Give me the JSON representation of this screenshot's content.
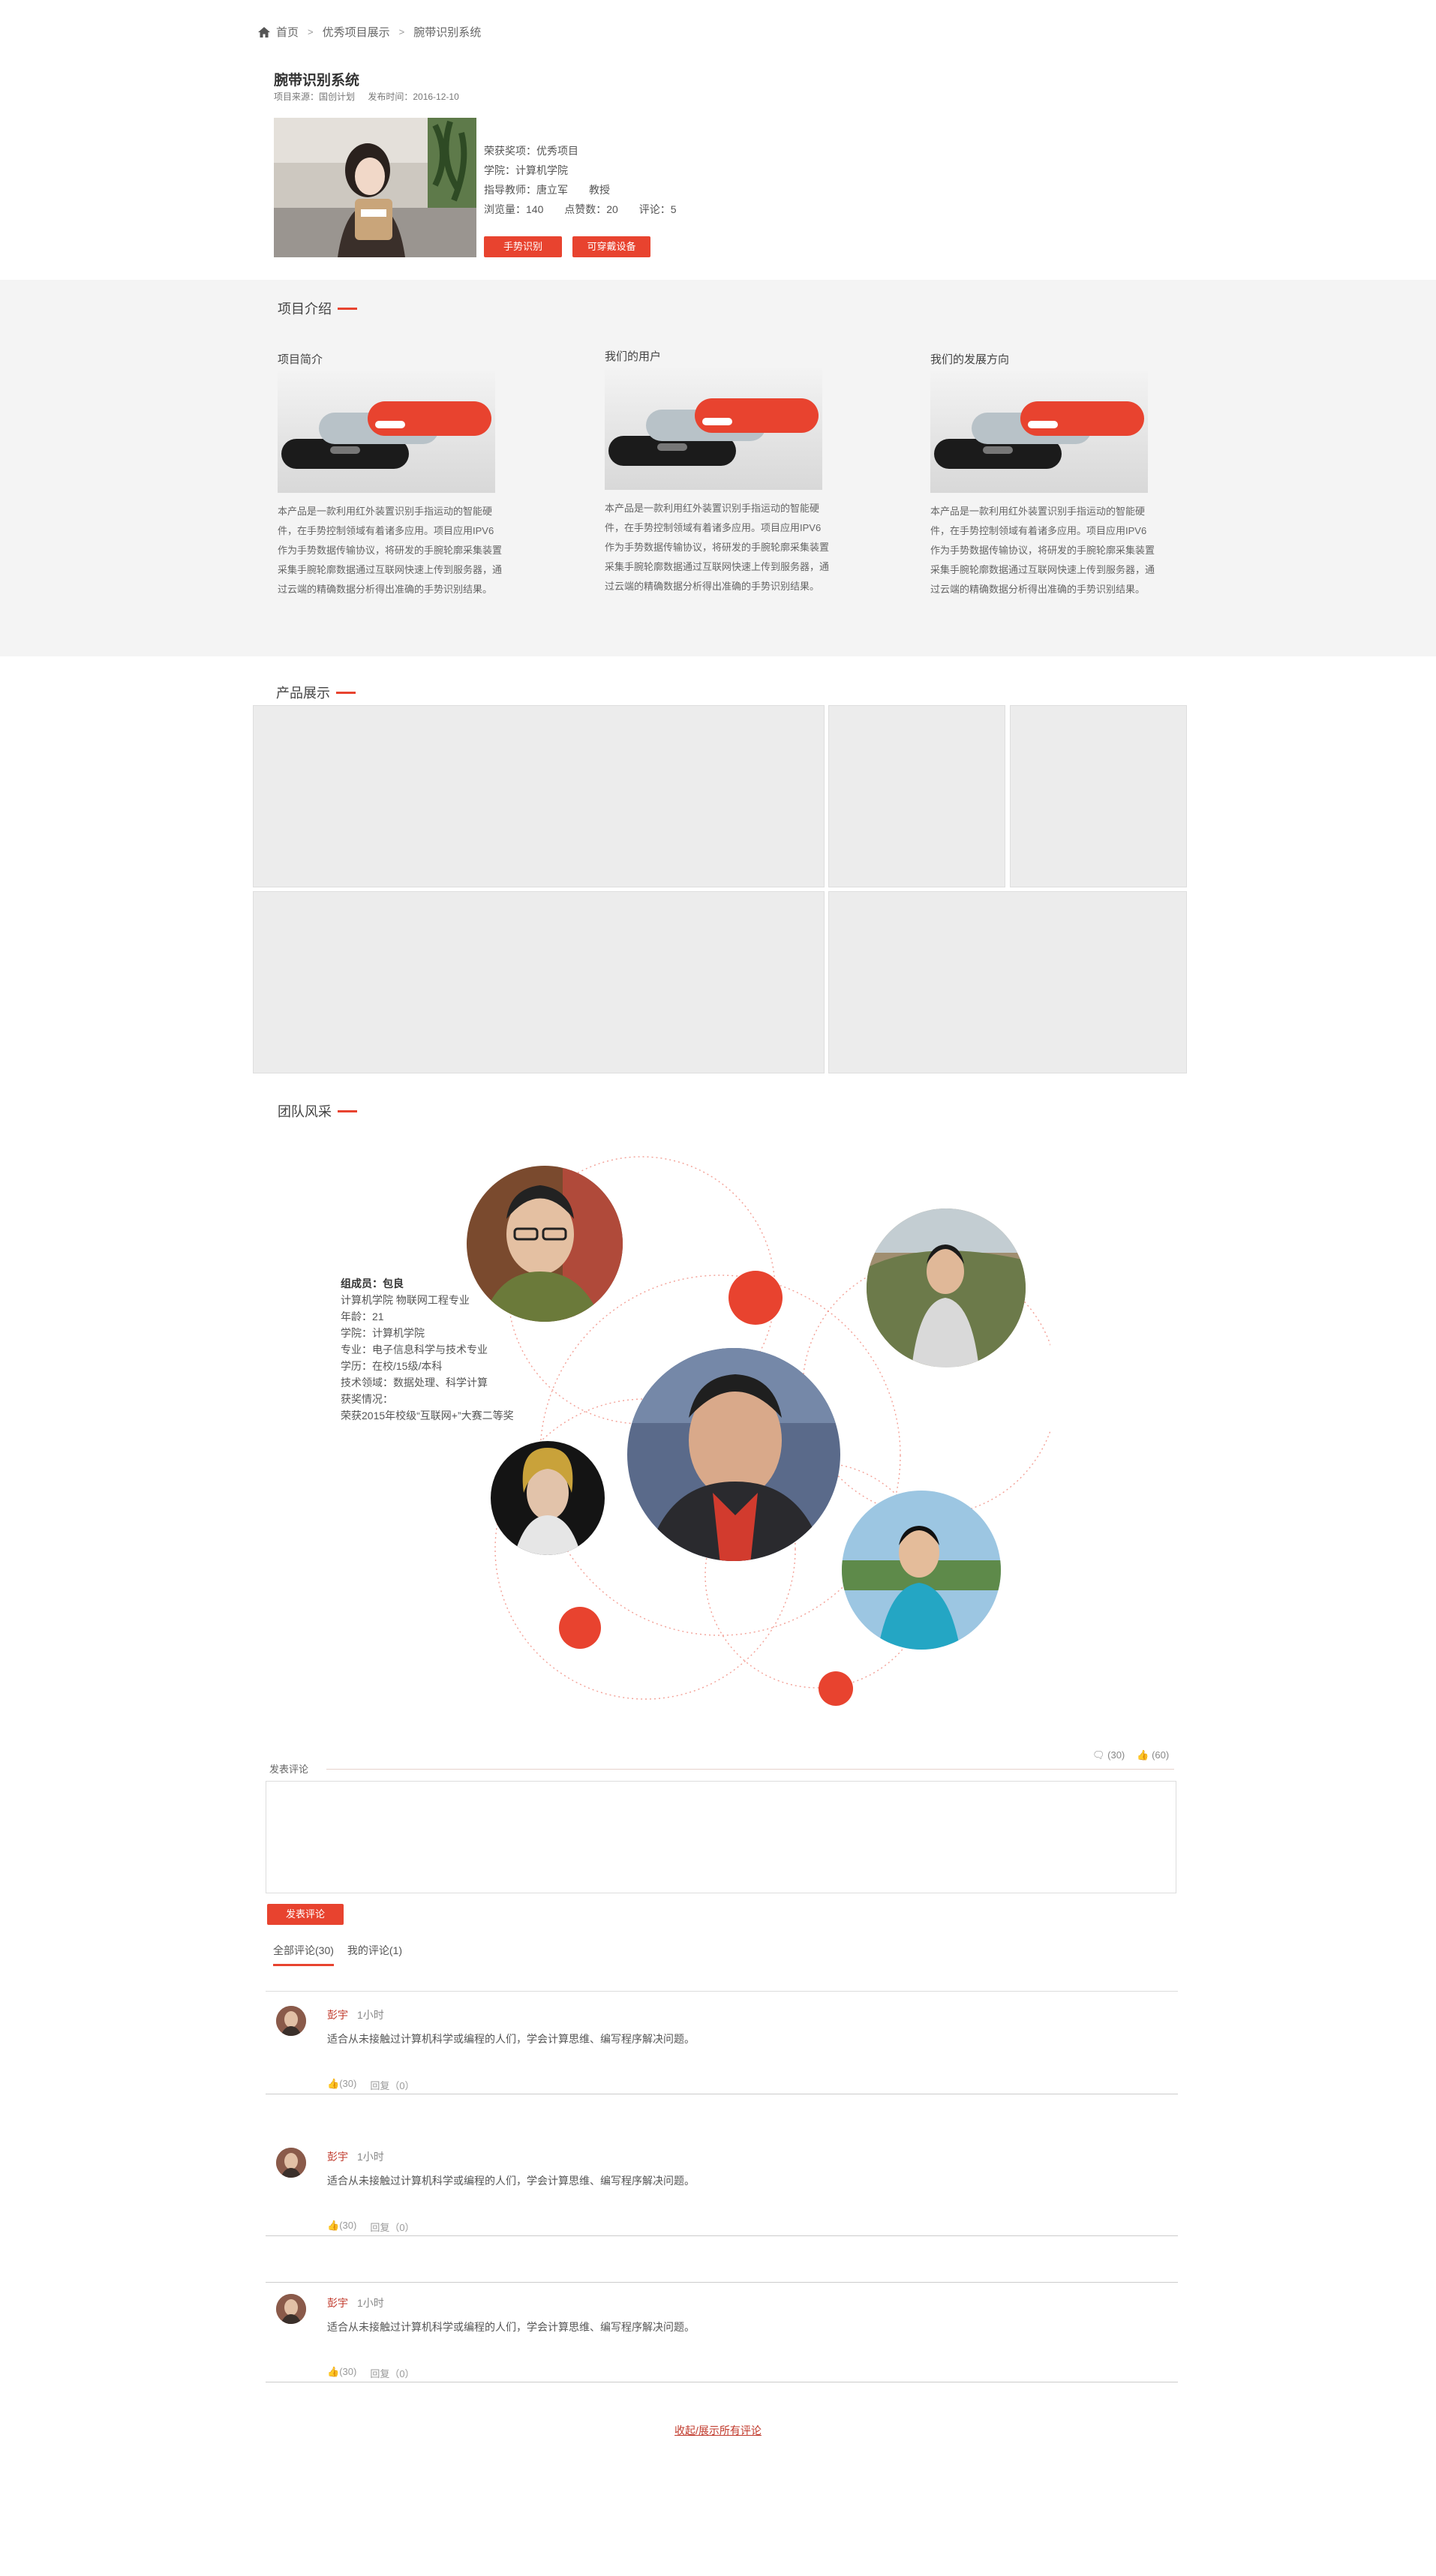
{
  "breadcrumb": {
    "home": "首页",
    "sep": ">",
    "level2": "优秀项目展示",
    "current": "腕带识别系统"
  },
  "project": {
    "title": "腕带识别系统",
    "source": "项目来源：国创计划",
    "date": "发布时间：2016-12-10",
    "award": "荣获奖项：优秀项目",
    "college": "学院：计算机学院",
    "advisor": "指导教师：唐立军　　教授",
    "views": "浏览量：140",
    "likes": "点赞数：20",
    "comments": "评论：5",
    "btn1": "手势识别",
    "btn2": "可穿戴设备"
  },
  "intro": {
    "title": "项目介绍",
    "cols": [
      {
        "heading": "项目简介",
        "text": "本产品是一款利用红外装置识别手指运动的智能硬件，在手势控制领域有着诸多应用。项目应用IPV6作为手势数据传输协议，将研发的手腕轮廓采集装置采集手腕轮廓数据通过互联网快速上传到服务器，通过云端的精确数据分析得出准确的手势识别结果。"
      },
      {
        "heading": "我们的用户",
        "text": "本产品是一款利用红外装置识别手指运动的智能硬件，在手势控制领域有着诸多应用。项目应用IPV6作为手势数据传输协议，将研发的手腕轮廓采集装置采集手腕轮廓数据通过互联网快速上传到服务器，通过云端的精确数据分析得出准确的手势识别结果。"
      },
      {
        "heading": "我们的发展方向",
        "text": "本产品是一款利用红外装置识别手指运动的智能硬件，在手势控制领域有着诸多应用。项目应用IPV6作为手势数据传输协议，将研发的手腕轮廓采集装置采集手腕轮廓数据通过互联网快速上传到服务器，通过云端的精确数据分析得出准确的手势识别结果。"
      }
    ]
  },
  "products": {
    "title": "产品展示"
  },
  "team": {
    "title": "团队风采",
    "member": {
      "name": "组成员：包良",
      "l1": "计算机学院 物联网工程专业",
      "l2": "年龄：21",
      "l3": "学院：计算机学院",
      "l4": "专业：电子信息科学与技术专业",
      "l5": "学历：在校/15级/本科",
      "l6": "技术领域：数据处理、科学计算",
      "l7": "获奖情况：",
      "l8": "荣获2015年校级“互联网+”大赛二等奖"
    },
    "accent": "#e8432f"
  },
  "comments": {
    "label": "发表评论",
    "count_comments": "(30)",
    "count_likes": "(60)",
    "submit": "发表评论",
    "tab_all": "全部评论(30)",
    "tab_mine": "我的评论(1)",
    "items": [
      {
        "user": "彭宇",
        "time": "1小时",
        "text": "适合从未接触过计算机科学或编程的人们，学会计算思维、编写程序解决问题。",
        "likes": "(30)",
        "reply": "回复（0）"
      },
      {
        "user": "彭宇",
        "time": "1小时",
        "text": "适合从未接触过计算机科学或编程的人们，学会计算思维、编写程序解决问题。",
        "likes": "(30)",
        "reply": "回复（0）"
      },
      {
        "user": "彭宇",
        "time": "1小时",
        "text": "适合从未接触过计算机科学或编程的人们，学会计算思维、编写程序解决问题。",
        "likes": "(30)",
        "reply": "回复（0）"
      }
    ],
    "toggle": "收起/展示所有评论"
  }
}
